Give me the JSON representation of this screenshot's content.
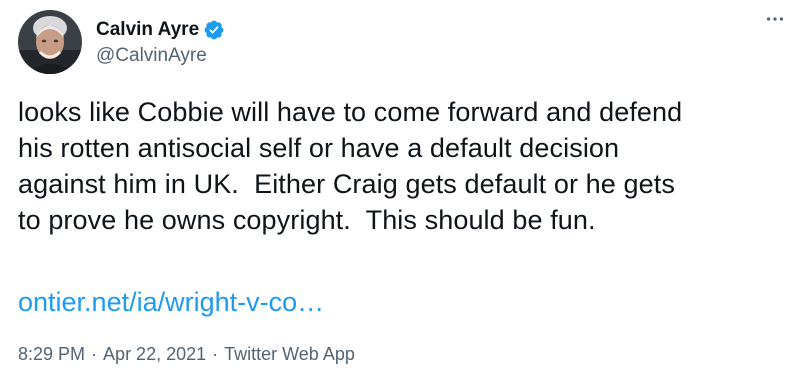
{
  "author": {
    "display_name": "Calvin Ayre",
    "handle": "@CalvinAyre",
    "verified": true
  },
  "icons": {
    "verified": "verified-badge-icon",
    "more": "more-horizontal-icon"
  },
  "colors": {
    "accent": "#1d9bf0",
    "text": "#0f1419",
    "secondary": "#536471"
  },
  "tweet": {
    "lines": [
      "looks like Cobbie will have to come forward and defend",
      "his rotten antisocial self or have a default decision",
      "against him in UK.  Either Craig gets default or he gets",
      "to prove he owns copyright.  This should be fun."
    ],
    "link_text": "ontier.net/ia/wright-v-co…"
  },
  "meta": {
    "time": "8:29 PM",
    "date": "Apr 22, 2021",
    "separator": "·",
    "source": "Twitter Web App"
  }
}
